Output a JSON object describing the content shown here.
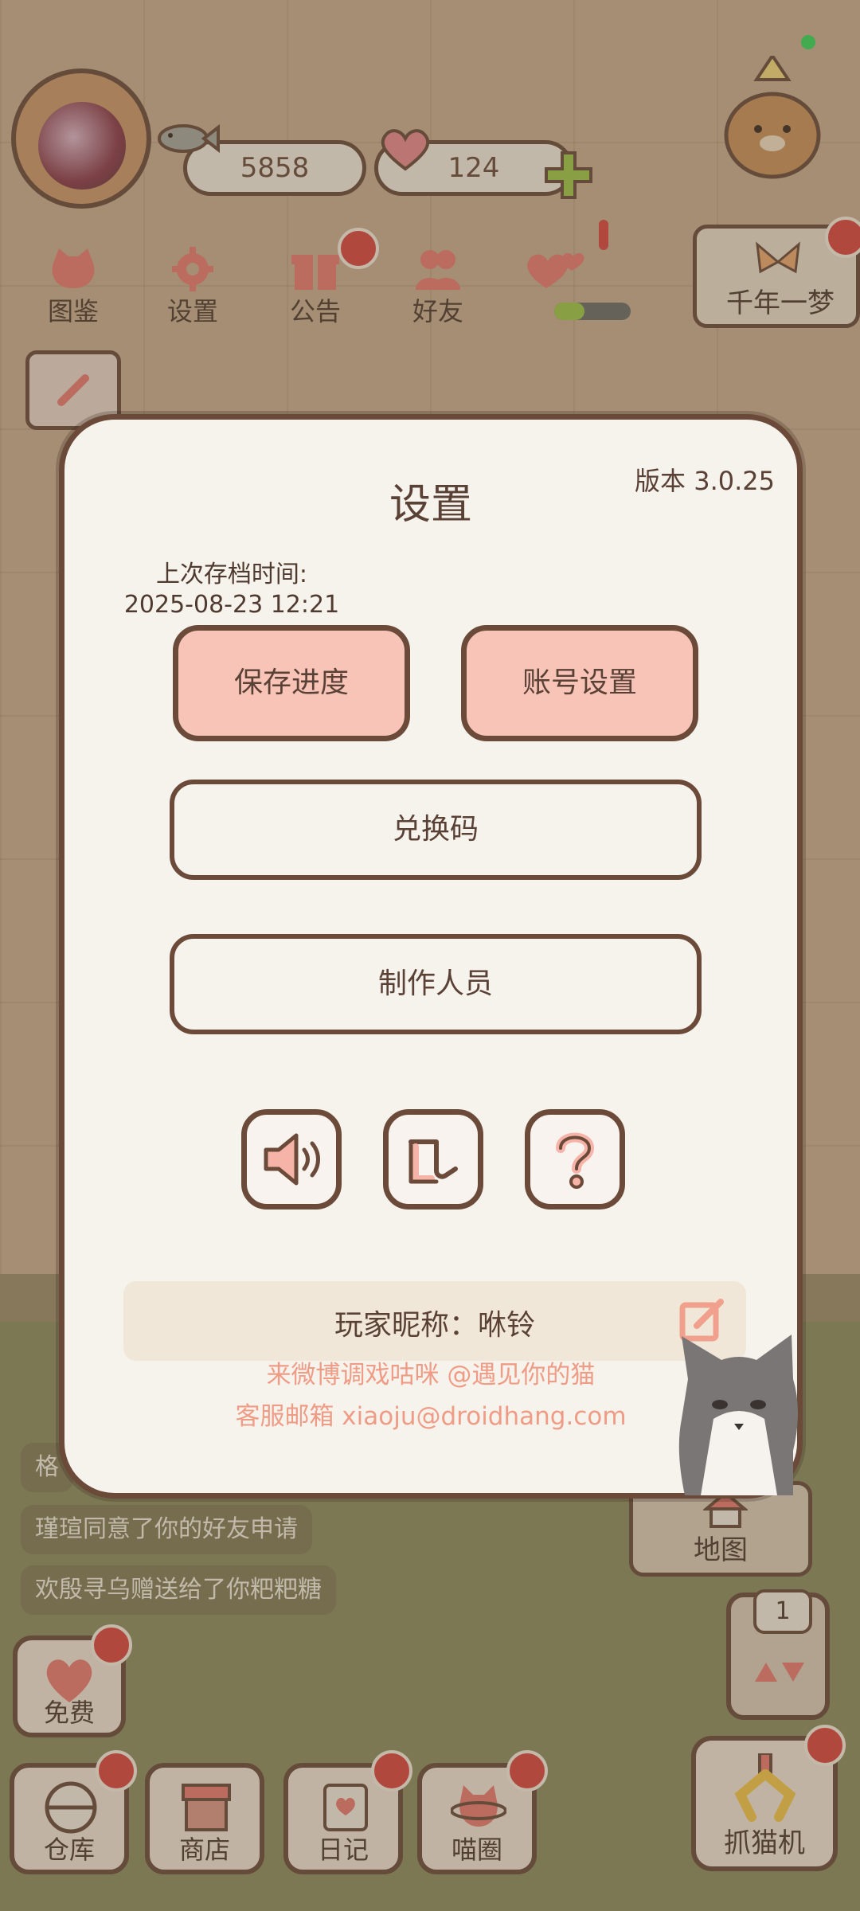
{
  "hud": {
    "fish_count": "5858",
    "heart_count": "124"
  },
  "menu": {
    "items": [
      {
        "label": "图鉴",
        "icon": "cat-book-icon"
      },
      {
        "label": "设置",
        "icon": "gear-icon"
      },
      {
        "label": "公告",
        "icon": "gift-icon"
      },
      {
        "label": "好友",
        "icon": "friends-icon"
      },
      {
        "label": "",
        "icon": "hearts-icon"
      }
    ],
    "banner_label": "千年一梦"
  },
  "dialog": {
    "title": "设置",
    "version": "版本 3.0.25",
    "last_save_label": "上次存档时间:",
    "last_save_time": "2025-08-23 12:21",
    "save_button": "保存进度",
    "account_button": "账号设置",
    "redeem_button": "兑换码",
    "credits_button": "制作人员",
    "icon_buttons": [
      "speaker-icon",
      "music-icon",
      "help-icon"
    ],
    "nickname": "玩家昵称：咻铃",
    "weibo_text": "来微博调戏咕咪 @遇见你的猫",
    "email_text": "客服邮箱 xiaoju@droidhang.com"
  },
  "feed": {
    "messages": [
      "格",
      "瑾瑄同意了你的好友申请",
      "欢殷寻乌赠送给了你粑粑糖"
    ]
  },
  "bottom": {
    "free_label": "免费",
    "warehouse_label": "仓库",
    "shop_label": "商店",
    "diary_label": "日记",
    "circle_label": "喵圈",
    "map_label": "地图",
    "gacha_count": "1",
    "claw_label": "抓猫机"
  },
  "colors": {
    "accent_pink": "#f9c4b8",
    "outline_brown": "#6b4a3a",
    "link_salmon": "#ef9c86",
    "notification_red": "#d6453f"
  }
}
